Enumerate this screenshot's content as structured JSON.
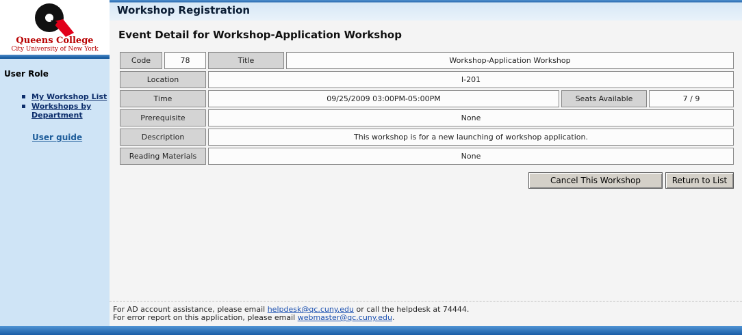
{
  "logo": {
    "name": "Queens College",
    "subtitle": "City University of New York"
  },
  "header": {
    "title": "Workshop Registration"
  },
  "sidebar": {
    "role_heading": "User Role",
    "nav": [
      {
        "label": "My Workshop List"
      },
      {
        "label": "Workshops by Department"
      }
    ],
    "user_guide": "User guide"
  },
  "page": {
    "title": "Event Detail for Workshop-Application Workshop"
  },
  "event": {
    "code_label": "Code",
    "code": "78",
    "title_label": "Title",
    "title": "Workshop-Application Workshop",
    "location_label": "Location",
    "location": "I-201",
    "time_label": "Time",
    "time": "09/25/2009 03:00PM-05:00PM",
    "seats_label": "Seats Available",
    "seats": "7 / 9",
    "prerequisite_label": "Prerequisite",
    "prerequisite": "None",
    "description_label": "Description",
    "description": "This workshop is for a new launching of workshop application.",
    "reading_label": "Reading Materials",
    "reading": "None"
  },
  "buttons": {
    "cancel": "Cancel This Workshop",
    "return": "Return to List"
  },
  "footer": {
    "line1_pre": "For AD account assistance, please email ",
    "helpdesk_email": "helpdesk@qc.cuny.edu",
    "line1_post": " or call the helpdesk at 74444.",
    "line2_pre": "For error report on this application, please email ",
    "webmaster_email": "webmaster@qc.cuny.edu",
    "line2_post": "."
  }
}
